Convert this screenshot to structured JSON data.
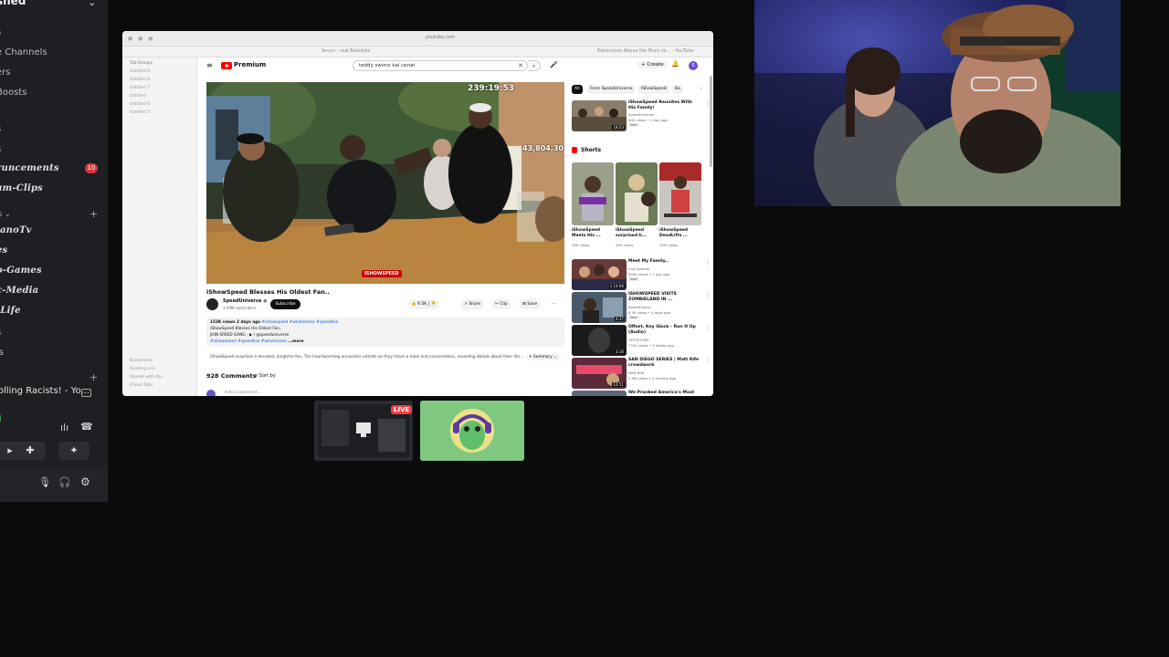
{
  "discord": {
    "server_name": "shed",
    "items": [
      {
        "label": "e Channels",
        "type": "plain"
      },
      {
        "label": "ers",
        "type": "plain"
      },
      {
        "label": "Boosts",
        "type": "plain"
      },
      {
        "label": "runcements",
        "type": "channel",
        "badge": "10"
      },
      {
        "label": "am-Clips",
        "type": "channel"
      },
      {
        "label": "ls",
        "type": "category"
      },
      {
        "label": "lanoTv",
        "type": "channel"
      },
      {
        "label": "es",
        "type": "channel"
      },
      {
        "label": "o-Games",
        "type": "channel"
      },
      {
        "label": "c-Media",
        "type": "channel"
      },
      {
        "label": "-Life",
        "type": "channel"
      },
      {
        "label": "ls",
        "type": "channel"
      }
    ],
    "now_playing": "rolling Racists! - Yo...",
    "voice_status": "d"
  },
  "browser": {
    "url": "youtube.com",
    "tabs": [
      "Sevyn - real Beauties",
      "Extensions Above the Brain to... - YouTube"
    ],
    "sidebar": {
      "heading": "Tab Groups",
      "items": [
        "Untitled 9",
        "Untitled 8",
        "Untitled 7",
        "Untitled",
        "Untitled 6",
        "Untitled 5"
      ],
      "bottom": [
        "Bookmarks",
        "Reading List",
        "Shared with You",
        "iCloud Tabs"
      ]
    }
  },
  "youtube": {
    "brand": "Premium",
    "search_value": "teddy swims kai cenat",
    "create_label": "Create",
    "avatar_letter": "S",
    "video": {
      "timestamp": "239:19:53",
      "counter": "43,804,30",
      "watermark": "ISHOWSPEED",
      "title": "iShowSpeed Blesses His Oldest Fan..",
      "channel": "SpeedUniverse",
      "subscribers": "3.59M subscribers",
      "subscribe_label": "Subscribe",
      "likes": "9.5K",
      "share": "Share",
      "clip": "Clip",
      "save": "Save",
      "desc_line1_stats": "153K views  2 days ago",
      "desc_line1_tags": "#ishowspeed #wholesome #speedlive",
      "desc_line2": "iShowSpeed Blesses His Oldest Fan..",
      "desc_line3": "JOIN SPEED GANG - ▶ / @speeduniverse",
      "desc_line4_tags": "#ishowspeed #speedlive #wholesome",
      "desc_more": "...more",
      "summary_text": "iShowSpeed surprises a devoted, longtime fan. The heartwarming encounter unfolds as they share a meal and conversation, revealing details about their life...",
      "summary_btn": "Summary",
      "comments": "928 Comments",
      "sort": "Sort by",
      "add_comment": "Add a comment..."
    },
    "chips": [
      "All",
      "From SpeedUniverse",
      "IShowSpeed",
      "Ba"
    ],
    "shorts_label": "Shorts",
    "recommended_top": {
      "title": "iShowSpeed Reunites With His Family!",
      "channel": "SpeedUniverse",
      "meta": "40K views • 1 day ago",
      "badge": "New",
      "duration": "18:53"
    },
    "shorts": [
      {
        "title": "iShowSpeed Meets His ...",
        "views": "28K views"
      },
      {
        "title": "iShowSpeed surprised h...",
        "views": "20K views"
      },
      {
        "title": "iShowSpeed DeadLifts ...",
        "views": "15M views"
      }
    ],
    "recommended": [
      {
        "title": "Meet My Family..",
        "channel": "Live Speedy",
        "meta": "400K views • 1 day ago",
        "badge": "New",
        "duration": "1:14:06"
      },
      {
        "title": "ISHOWSPEED VISITS ZOMBIELAND IN ...",
        "channel": "SpeedColony",
        "meta": "6.3K views • 4 days ago",
        "badge": "New",
        "duration": "4:37"
      },
      {
        "title": "Offset, Key Glock - Run It Up (Audio)",
        "channel": "OFFSETYRN",
        "meta": "731K views • 2 weeks ago",
        "badge": "",
        "duration": "3:16"
      },
      {
        "title": "SAN DIEGO SERIES | Matt Rife crowdwork",
        "channel": "Matt Rife",
        "meta": "2.9M views • 4 months ago",
        "badge": "",
        "duration": "13:51"
      },
      {
        "title": "We Pranked America's Most",
        "channel": "",
        "meta": "",
        "badge": "",
        "duration": ""
      }
    ]
  },
  "stream": {
    "live_label": "LIVE"
  }
}
